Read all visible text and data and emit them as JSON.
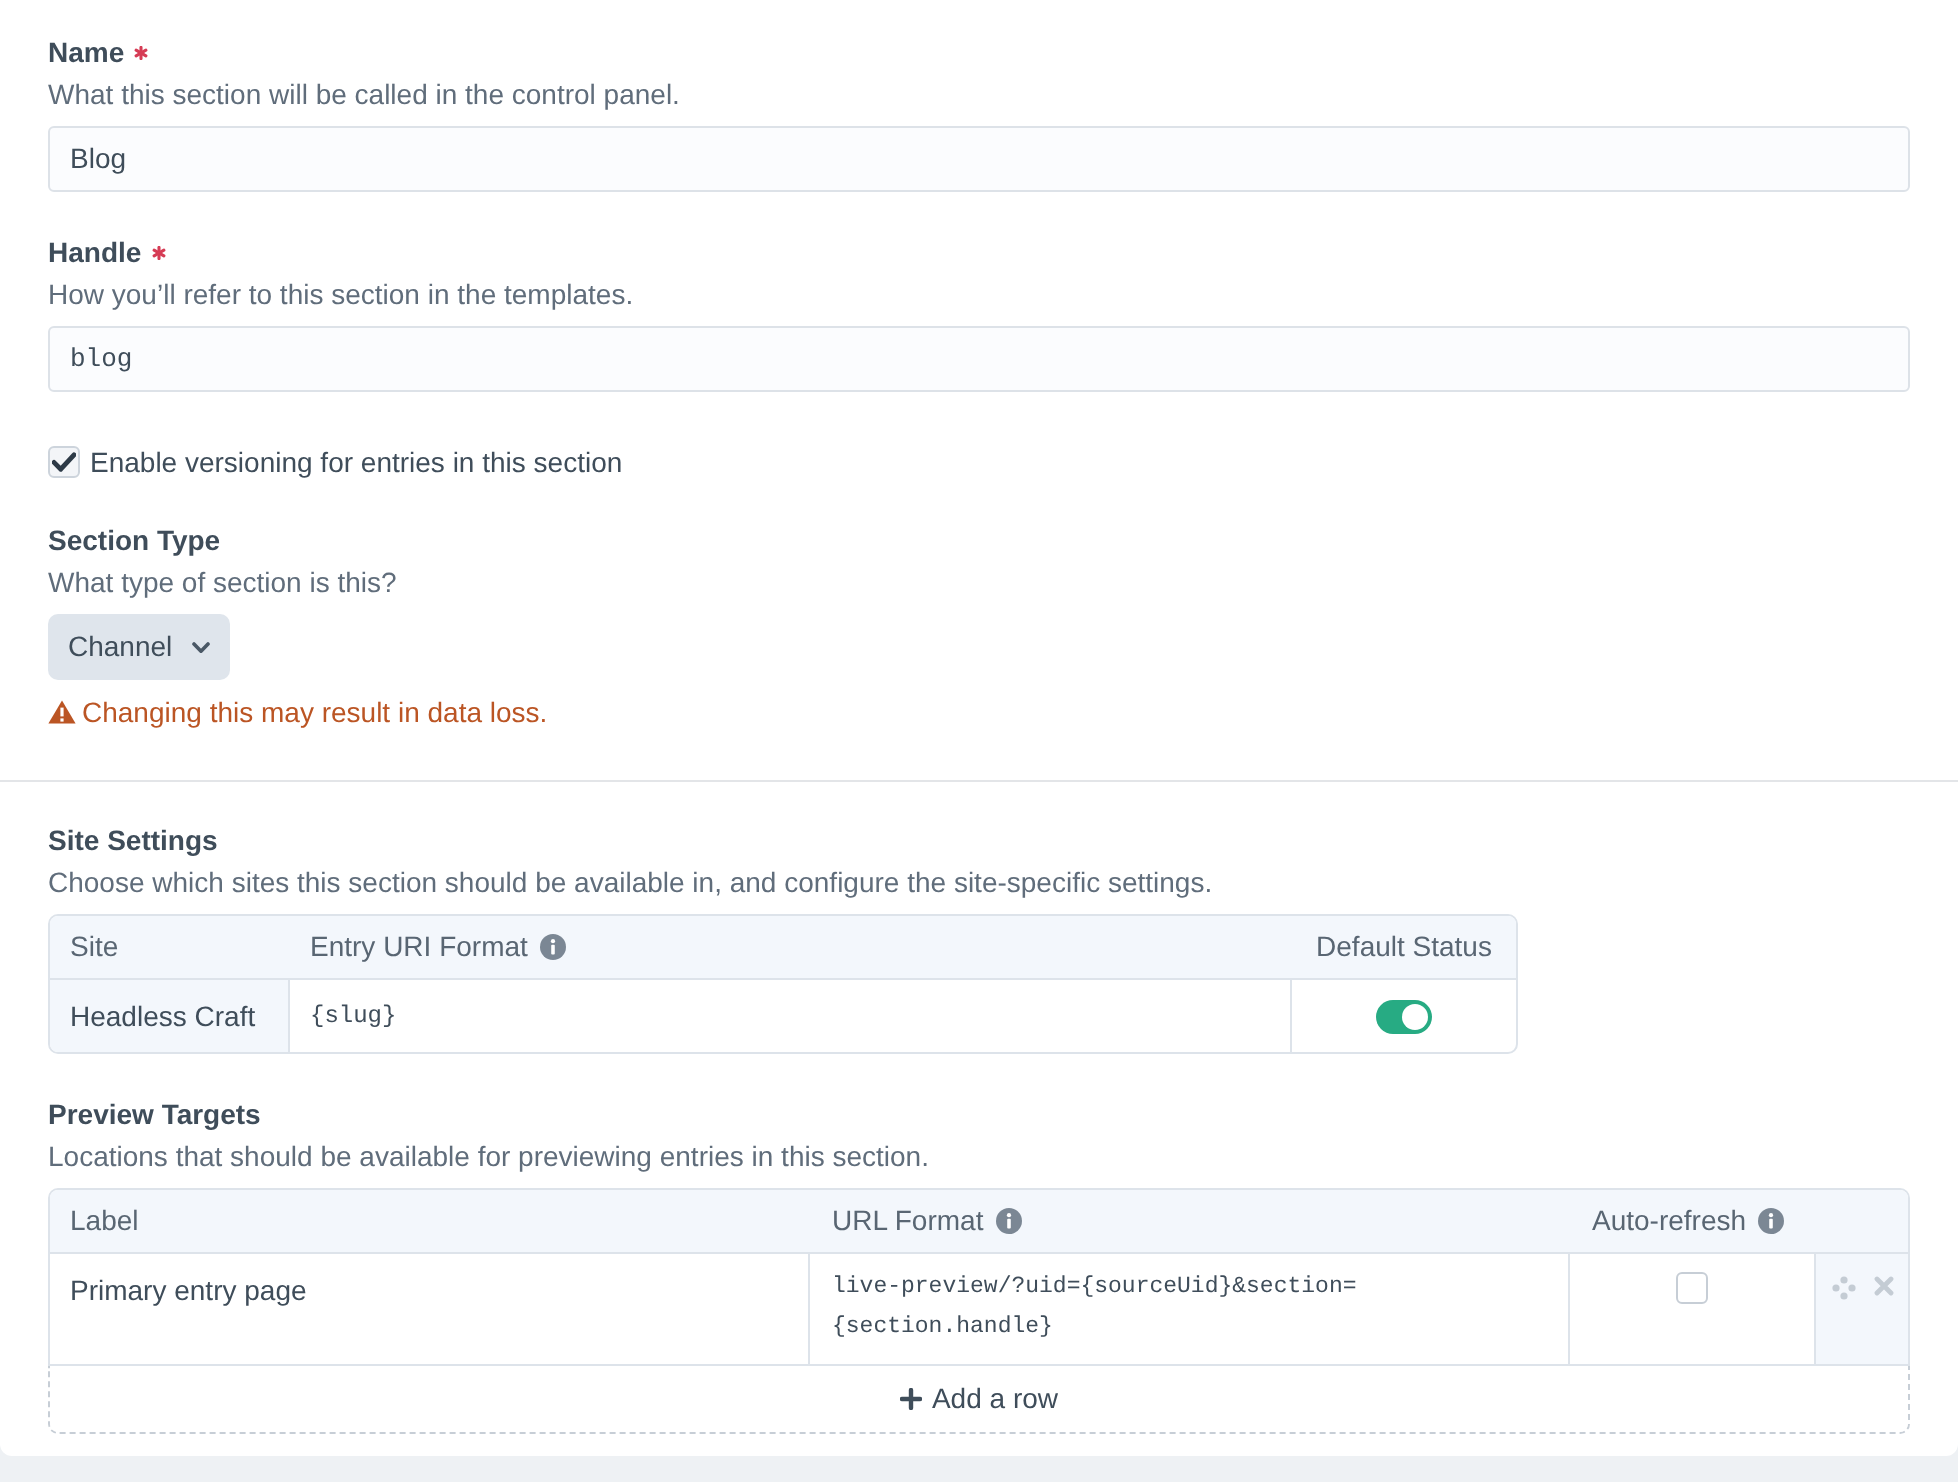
{
  "fields": [
    {
      "kind": "text",
      "label": "Name",
      "required": true,
      "instructions": "What this section will be called in the control panel.",
      "value": "Blog"
    },
    {
      "kind": "code",
      "label": "Handle",
      "required": true,
      "instructions": "How you’ll refer to this section in the templates.",
      "value": "blog"
    }
  ],
  "versioning": {
    "label": "Enable versioning for entries in this section",
    "checked": true
  },
  "section_type": {
    "label": "Section Type",
    "instructions": "What type of section is this?",
    "value": "Channel",
    "warning": "Changing this may result in data loss."
  },
  "site_settings": {
    "heading": "Site Settings",
    "instructions": "Choose which sites this section should be available in, and configure the site-specific settings.",
    "columns": [
      {
        "label": "Site",
        "info": false
      },
      {
        "label": "Entry URI Format",
        "info": true
      },
      {
        "label": "Default Status",
        "info": false
      }
    ],
    "rows": [
      {
        "site": "Headless Craft",
        "uri_format": "{slug}",
        "enabled": true
      }
    ]
  },
  "preview_targets": {
    "heading": "Preview Targets",
    "instructions": "Locations that should be available for previewing entries in this section.",
    "columns": [
      {
        "label": "Label",
        "info": false
      },
      {
        "label": "URL Format",
        "info": true
      },
      {
        "label": "Auto-refresh",
        "info": true
      }
    ],
    "rows": [
      {
        "label": "Primary entry page",
        "url_format": "live-preview/?uid={sourceUid}&section={section.handle}",
        "auto_refresh": false
      }
    ],
    "add_button": "Add a row"
  }
}
